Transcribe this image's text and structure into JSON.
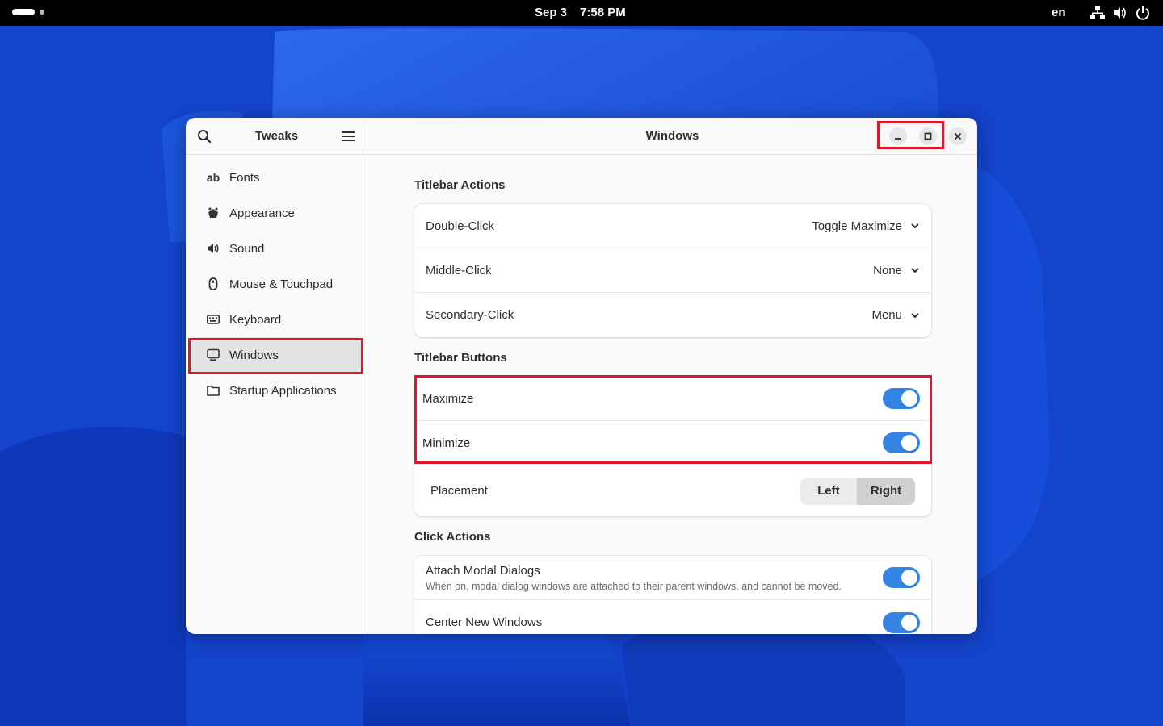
{
  "topbar": {
    "date": "Sep 3",
    "time": "7:58 PM",
    "language": "en"
  },
  "sidebar": {
    "title": "Tweaks",
    "items": [
      {
        "label": "Fonts",
        "icon": "fonts-icon"
      },
      {
        "label": "Appearance",
        "icon": "appearance-icon"
      },
      {
        "label": "Sound",
        "icon": "speaker-icon"
      },
      {
        "label": "Mouse & Touchpad",
        "icon": "mouse-icon"
      },
      {
        "label": "Keyboard",
        "icon": "keyboard-icon"
      },
      {
        "label": "Windows",
        "icon": "monitor-icon",
        "active": true
      },
      {
        "label": "Startup Applications",
        "icon": "folder-icon"
      }
    ],
    "fonts_icon_glyph": "ab"
  },
  "main": {
    "title": "Windows",
    "titlebar_actions": {
      "heading": "Titlebar Actions",
      "rows": [
        {
          "label": "Double-Click",
          "value": "Toggle Maximize"
        },
        {
          "label": "Middle-Click",
          "value": "None"
        },
        {
          "label": "Secondary-Click",
          "value": "Menu"
        }
      ]
    },
    "titlebar_buttons": {
      "heading": "Titlebar Buttons",
      "maximize": {
        "label": "Maximize",
        "on": true
      },
      "minimize": {
        "label": "Minimize",
        "on": true
      },
      "placement": {
        "label": "Placement",
        "left": "Left",
        "right": "Right",
        "selected": "Right"
      }
    },
    "click_actions": {
      "heading": "Click Actions",
      "attach_modal": {
        "label": "Attach Modal Dialogs",
        "description": "When on, modal dialog windows are attached to their parent windows, and cannot be moved.",
        "on": true
      },
      "center_new": {
        "label": "Center New Windows",
        "on": true
      }
    }
  },
  "colors": {
    "accent": "#3584e4",
    "highlight": "#e0162b",
    "wallpaper": "#1746cf"
  }
}
